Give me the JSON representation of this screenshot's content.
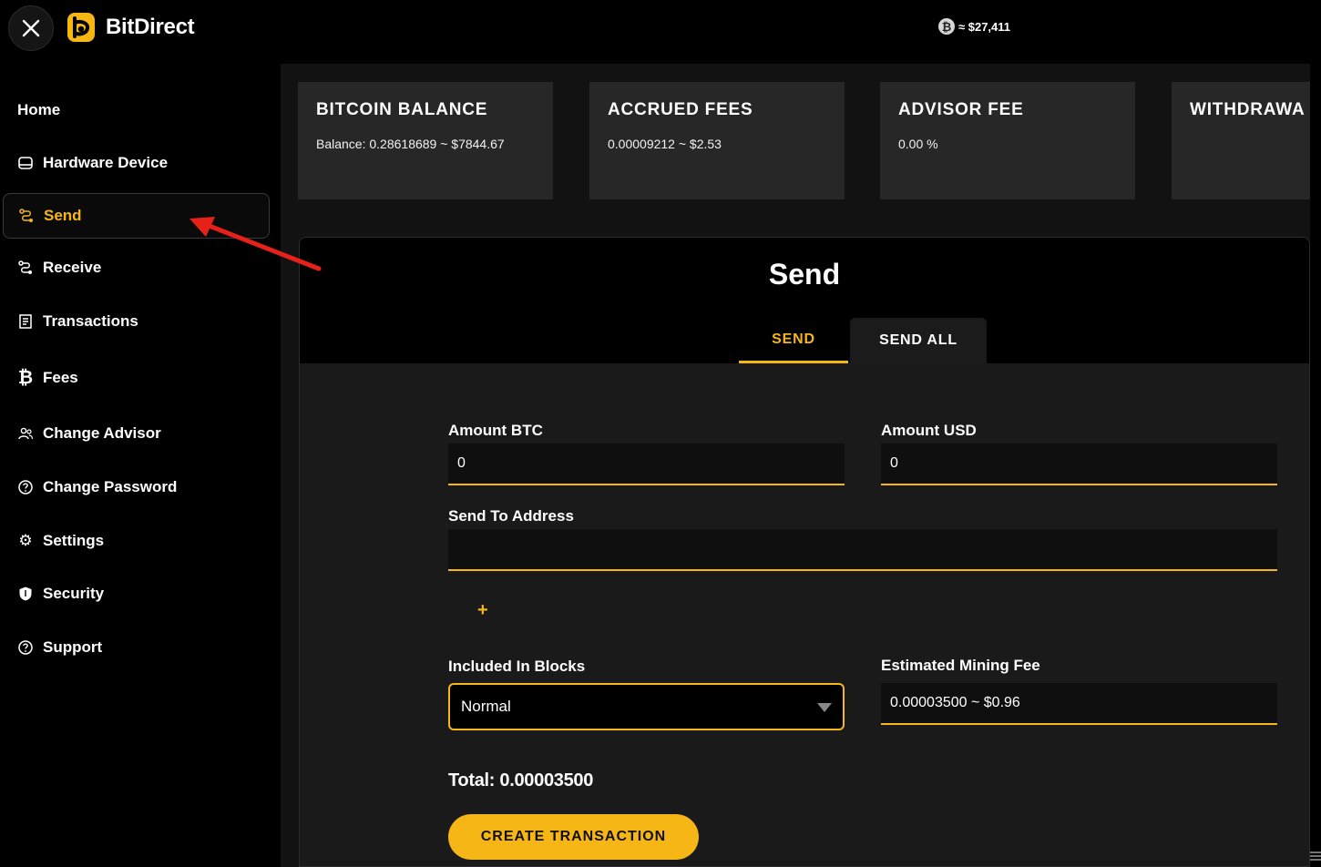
{
  "header": {
    "close_icon": "close-icon",
    "brand_name": "BitDirect",
    "btc_symbol": "₿",
    "btc_price": "≈ $27,411"
  },
  "sidebar": {
    "items": [
      {
        "label": "Home",
        "icon": ""
      },
      {
        "label": "Hardware Device",
        "icon": "hardware-device-icon"
      },
      {
        "label": "Send",
        "icon": "send-route-icon",
        "active": true
      },
      {
        "label": "Receive",
        "icon": "receive-route-icon"
      },
      {
        "label": "Transactions",
        "icon": "receipt-icon"
      },
      {
        "label": "Fees",
        "icon": "bitcoin-icon"
      },
      {
        "label": "Change Advisor",
        "icon": "users-icon"
      },
      {
        "label": "Change Password",
        "icon": "help-circle-icon"
      },
      {
        "label": "Settings",
        "icon": "gear-icon"
      },
      {
        "label": "Security",
        "icon": "shield-icon"
      },
      {
        "label": "Support",
        "icon": "help-circle-icon"
      }
    ]
  },
  "cards": [
    {
      "title": "BITCOIN BALANCE",
      "value": "Balance: 0.28618689 ~ $7844.67"
    },
    {
      "title": "ACCRUED FEES",
      "value": "0.00009212 ~ $2.53"
    },
    {
      "title": "ADVISOR FEE",
      "value": "0.00 %"
    },
    {
      "title": "WITHDRAWA",
      "value": ""
    }
  ],
  "send_panel": {
    "title": "Send",
    "tabs": [
      "SEND",
      "SEND ALL"
    ],
    "amount_btc_label": "Amount BTC",
    "amount_btc_value": "0",
    "amount_usd_label": "Amount USD",
    "amount_usd_value": "0",
    "address_label": "Send To Address",
    "address_value": "",
    "add_symbol": "+",
    "blocks_label": "Included In Blocks",
    "blocks_selected": "Normal",
    "fee_label": "Estimated Mining Fee",
    "fee_value": "0.00003500 ~ $0.96",
    "total": "Total: 0.00003500",
    "create_button": "CREATE TRANSACTION"
  },
  "colors": {
    "accent": "#f6b716",
    "background": "#000000",
    "card": "#272727",
    "panel": "#1a1a1a",
    "annotation_arrow": "#e8201a"
  }
}
